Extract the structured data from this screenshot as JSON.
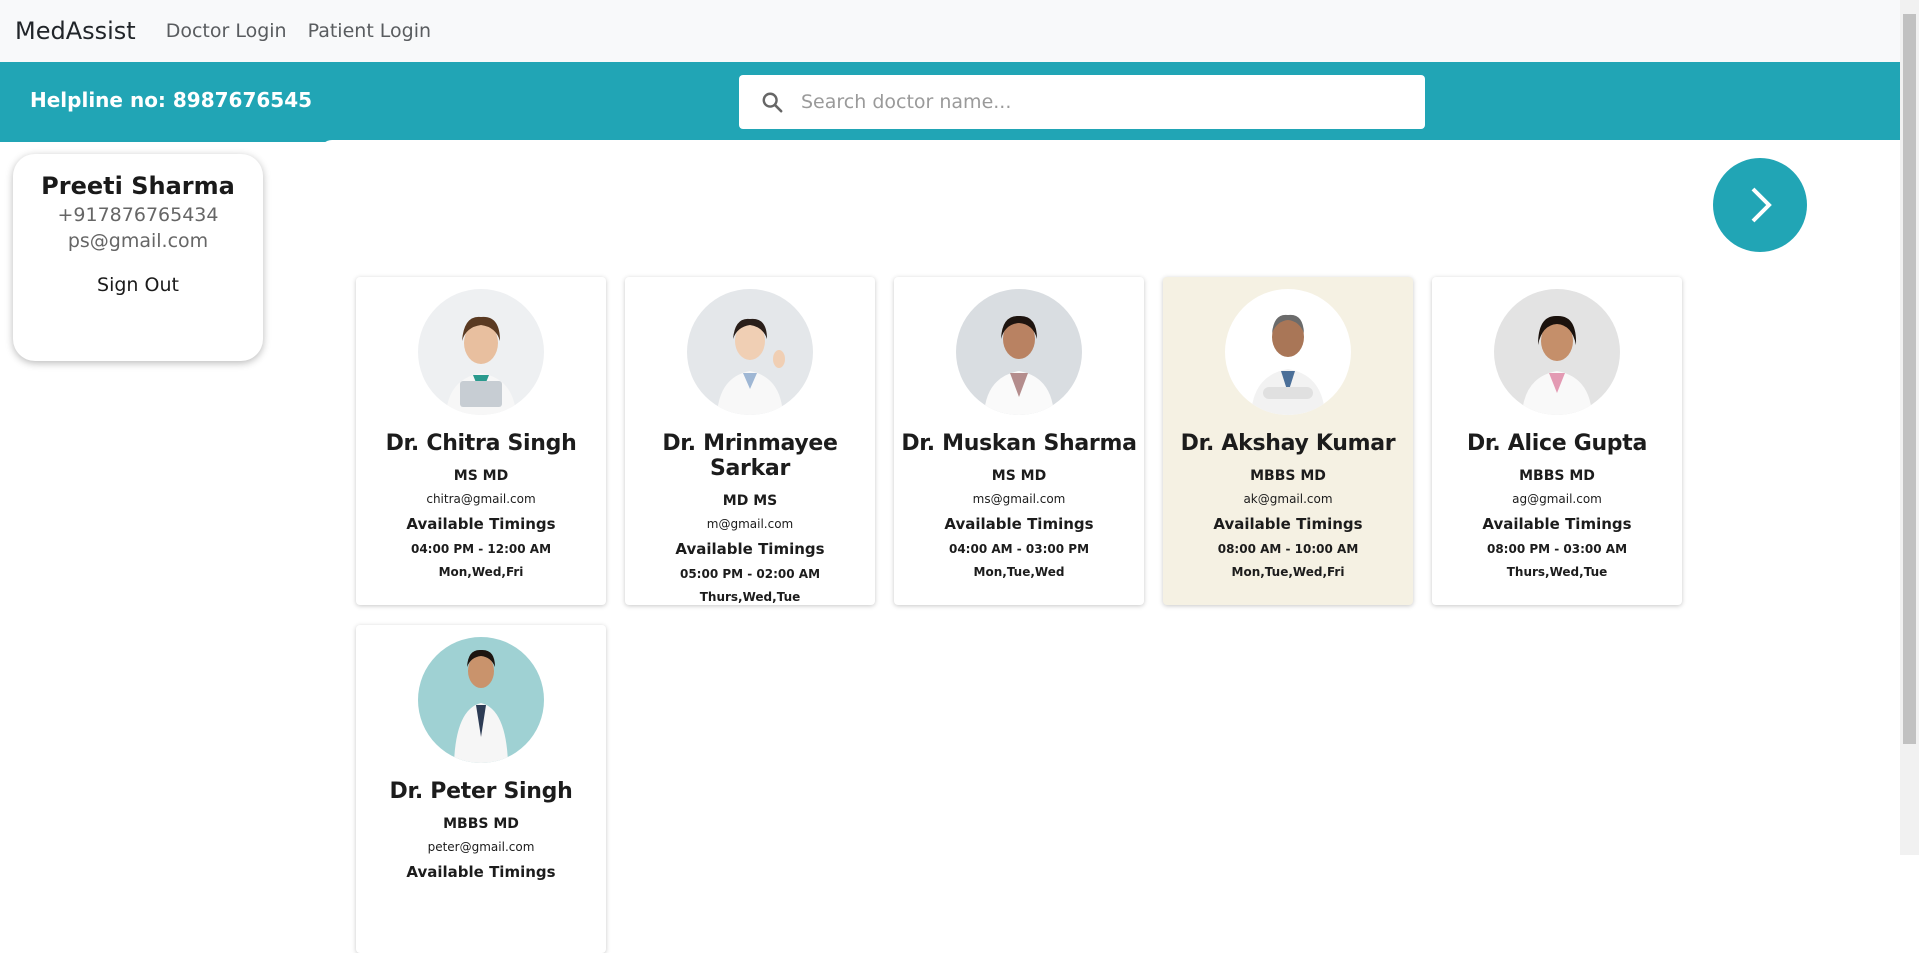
{
  "navbar": {
    "brand": "MedAssist",
    "links": [
      "Doctor Login",
      "Patient Login"
    ]
  },
  "header": {
    "helpline": "Helpline no: 8987676545",
    "search_placeholder": "Search doctor name...",
    "search_value": ""
  },
  "user": {
    "name": "Preeti Sharma",
    "phone": "+917876765434",
    "email": "ps@gmail.com",
    "signout_label": "Sign Out"
  },
  "colors": {
    "accent": "#21a5b5",
    "highlight_card": "#f5f1e3"
  },
  "icons": {
    "search": "search-icon",
    "next": "chevron-right-icon"
  },
  "doctors": [
    {
      "name": "Dr. Chitra Singh",
      "degree": "MS MD",
      "email": "chitra@gmail.com",
      "avail_label": "Available Timings",
      "time": "04:00 PM - 12:00 AM",
      "days": "Mon,Wed,Fri"
    },
    {
      "name": "Dr. Mrinmayee Sarkar",
      "degree": "MD MS",
      "email": "m@gmail.com",
      "avail_label": "Available Timings",
      "time": "05:00 PM - 02:00 AM",
      "days": "Thurs,Wed,Tue"
    },
    {
      "name": "Dr. Muskan Sharma",
      "degree": "MS MD",
      "email": "ms@gmail.com",
      "avail_label": "Available Timings",
      "time": "04:00 AM - 03:00 PM",
      "days": "Mon,Tue,Wed"
    },
    {
      "name": "Dr. Akshay Kumar",
      "degree": "MBBS MD",
      "email": "ak@gmail.com",
      "avail_label": "Available Timings",
      "time": "08:00 AM - 10:00 AM",
      "days": "Mon,Tue,Wed,Fri"
    },
    {
      "name": "Dr. Alice Gupta",
      "degree": "MBBS MD",
      "email": "ag@gmail.com",
      "avail_label": "Available Timings",
      "time": "08:00 PM - 03:00 AM",
      "days": "Thurs,Wed,Tue"
    },
    {
      "name": "Dr. Peter Singh",
      "degree": "MBBS MD",
      "email": "peter@gmail.com",
      "avail_label": "Available Timings",
      "time": "",
      "days": ""
    }
  ]
}
